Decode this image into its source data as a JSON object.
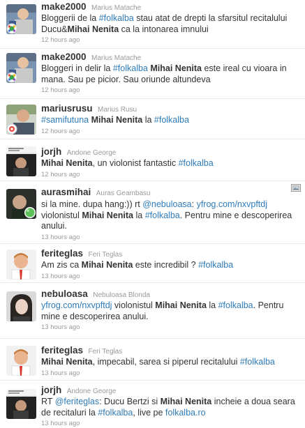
{
  "tweets": [
    {
      "username": "make2000",
      "realname": "Marius Matache",
      "parts": [
        {
          "t": "Bloggerii de la "
        },
        {
          "t": "#folkalba",
          "k": "link"
        },
        {
          "t": " stau atat de drepti la sfarsitul recitalului Ducu&"
        },
        {
          "t": "Mihai Nenita",
          "k": "bold"
        },
        {
          "t": " ca la intonarea imnului"
        }
      ],
      "time": "12 hours ago",
      "avatar": "user-photo-make2000"
    },
    {
      "username": "make2000",
      "realname": "Marius Matache",
      "parts": [
        {
          "t": "Bloggeri in delir la "
        },
        {
          "t": "#folkalba",
          "k": "link"
        },
        {
          "t": " "
        },
        {
          "t": "Mihai Nenita",
          "k": "bold"
        },
        {
          "t": " este ireal cu vioara in mana. Sau pe picior. Sau oriunde altundeva"
        }
      ],
      "time": "12 hours ago",
      "avatar": "user-photo-make2000"
    },
    {
      "username": "mariusrusu",
      "realname": "Marius Rusu",
      "parts": [
        {
          "t": "#samifutuna",
          "k": "link"
        },
        {
          "t": " "
        },
        {
          "t": "Mihai Nenita",
          "k": "bold"
        },
        {
          "t": " la "
        },
        {
          "t": "#folkalba",
          "k": "link"
        }
      ],
      "time": "12 hours ago",
      "avatar": "user-photo-mariusrusu"
    },
    {
      "username": "jorjh",
      "realname": "Andone George",
      "parts": [
        {
          "t": "Mihai Nenita",
          "k": "bold"
        },
        {
          "t": ", un violonist fantastic "
        },
        {
          "t": "#folkalba",
          "k": "link"
        }
      ],
      "time": "12 hours ago",
      "avatar": "user-photo-jorjh"
    },
    {
      "username": "aurasmihai",
      "realname": "Auras Geambasu",
      "parts": [
        {
          "t": "si la mine. dupa hang:)) rt "
        },
        {
          "t": "@nebuloasa",
          "k": "link"
        },
        {
          "t": ": "
        },
        {
          "t": "yfrog.com/nxvpftdj",
          "k": "link"
        },
        {
          "t": " violonistul "
        },
        {
          "t": "Mihai Nenita",
          "k": "bold"
        },
        {
          "t": " la "
        },
        {
          "t": "#folkalba",
          "k": "link"
        },
        {
          "t": ". Pentru mine e descoperirea anului."
        }
      ],
      "time": "13 hours ago",
      "avatar": "user-photo-aurasmihai",
      "media": true
    },
    {
      "username": "feriteglas",
      "realname": "Feri Teglas",
      "parts": [
        {
          "t": "Am zis ca "
        },
        {
          "t": "Mihai Nenita",
          "k": "bold"
        },
        {
          "t": " este incredibil ? "
        },
        {
          "t": "#folkalba",
          "k": "link"
        }
      ],
      "time": "13 hours ago",
      "avatar": "user-photo-feriteglas"
    },
    {
      "username": "nebuloasa",
      "realname": "Nebuloasa Blonda",
      "parts": [
        {
          "t": "yfrog.com/nxvpftdj",
          "k": "link"
        },
        {
          "t": " violonistul "
        },
        {
          "t": "Mihai Nenita",
          "k": "bold"
        },
        {
          "t": " la "
        },
        {
          "t": "#folkalba",
          "k": "link"
        },
        {
          "t": ". Pentru mine e descoperirea anului."
        }
      ],
      "time": "13 hours ago",
      "avatar": "user-photo-nebuloasa"
    },
    {
      "username": "feriteglas",
      "realname": "Feri Teglas",
      "parts": [
        {
          "t": "Mihai Nenita",
          "k": "bold"
        },
        {
          "t": ", impecabil, sarea si piperul recitalului "
        },
        {
          "t": "#folkalba",
          "k": "link"
        }
      ],
      "time": "13 hours ago",
      "avatar": "user-photo-feriteglas"
    },
    {
      "username": "jorjh",
      "realname": "Andone George",
      "parts": [
        {
          "t": "RT "
        },
        {
          "t": "@feriteglas",
          "k": "link"
        },
        {
          "t": ": Ducu Bertzi si "
        },
        {
          "t": "Mihai Nenita",
          "k": "bold"
        },
        {
          "t": " incheie a doua seara de recitaluri la "
        },
        {
          "t": "#folkalba",
          "k": "link"
        },
        {
          "t": ", live pe "
        },
        {
          "t": "folkalba.ro",
          "k": "link"
        }
      ],
      "time": "13 hours ago",
      "avatar": "user-photo-jorjh"
    }
  ],
  "colors": {
    "link": "#2e7bb8",
    "text": "#333333",
    "meta": "#999999"
  }
}
